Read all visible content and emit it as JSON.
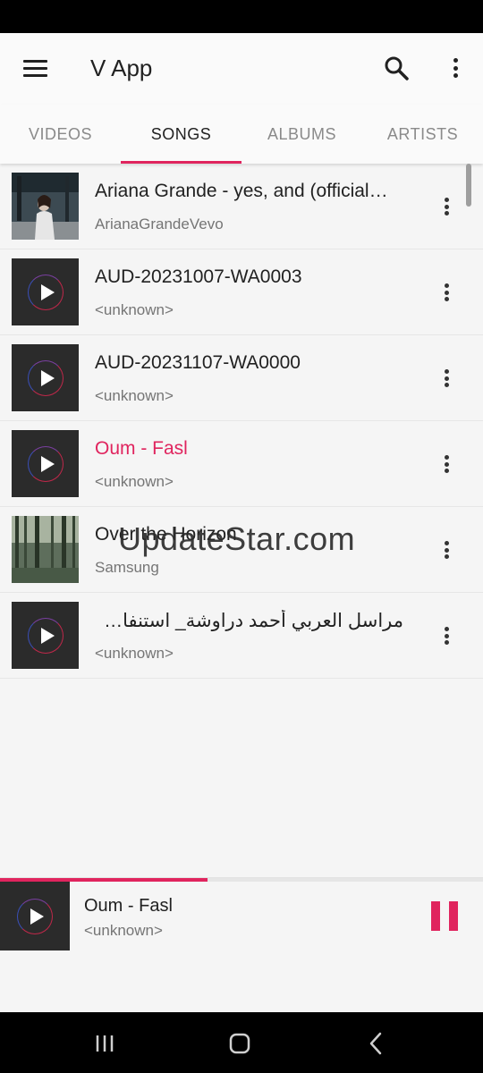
{
  "app": {
    "title": "V App"
  },
  "tabs": [
    {
      "label": "VIDEOS",
      "active": false
    },
    {
      "label": "SONGS",
      "active": true
    },
    {
      "label": "ALBUMS",
      "active": false
    },
    {
      "label": "ARTISTS",
      "active": false
    }
  ],
  "songs": [
    {
      "title": "Ariana Grande - yes, and (official…",
      "artist": "ArianaGrandeVevo",
      "thumbnail": "photo"
    },
    {
      "title": "AUD-20231007-WA0003",
      "artist": "<unknown>",
      "thumbnail": "play-icon"
    },
    {
      "title": "AUD-20231107-WA0000",
      "artist": "<unknown>",
      "thumbnail": "play-icon"
    },
    {
      "title": "Oum - Fasl",
      "artist": "<unknown>",
      "thumbnail": "play-icon",
      "playing": true
    },
    {
      "title": "Over the Horizon",
      "artist": "Samsung",
      "thumbnail": "photo"
    },
    {
      "title": "مراسل العربي أحمد دراوشة_ استنفار بمنط…",
      "artist": "<unknown>",
      "thumbnail": "play-icon"
    }
  ],
  "watermark": "UpdateStar.com",
  "now_playing": {
    "title": "Oum - Fasl",
    "artist": "<unknown>",
    "progress": 0.43,
    "state": "playing"
  },
  "colors": {
    "accent": "#e0245e",
    "status_bar": "#000000",
    "background": "#f5f5f5"
  },
  "icons": {
    "menu": "hamburger-icon",
    "search": "search-icon",
    "more": "more-vert-icon",
    "pause": "pause-icon",
    "nav_recents": "recents-icon",
    "nav_home": "home-icon",
    "nav_back": "back-icon"
  }
}
